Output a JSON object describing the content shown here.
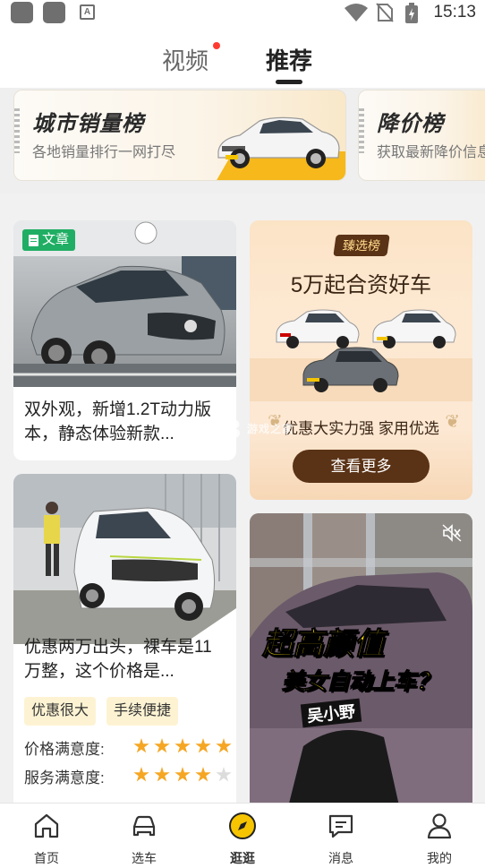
{
  "status_bar": {
    "time": "15:13"
  },
  "top_tabs": {
    "video": "视频",
    "recommend": "推荐"
  },
  "rankings": [
    {
      "title": "城市销量榜",
      "subtitle": "各地销量排行一网打尽"
    },
    {
      "title": "降价榜",
      "subtitle": "获取最新降价信息"
    }
  ],
  "feed": {
    "article_card": {
      "badge": "文章",
      "text": "双外观，新增1.2T动力版本，静态体验新款..."
    },
    "promo_card": {
      "tag": "臻选榜",
      "title": "5万起合资好车",
      "subtitle": "优惠大实力强 家用优选",
      "button": "查看更多"
    },
    "deal_card": {
      "text": "优惠两万出头，裸车是11万整，这个价格是...",
      "tags": [
        "优惠很大",
        "手续便捷"
      ],
      "ratings": [
        {
          "label": "价格满意度:",
          "stars": 5
        },
        {
          "label": "服务满意度:",
          "stars": 4
        }
      ]
    },
    "video_card": {
      "caption_line1": "超高颜值",
      "caption_line2": "美女自动上车？",
      "author": "吴小野"
    },
    "watermark": "K73",
    "watermark_sub": "游戏之家"
  },
  "bottom_nav": [
    {
      "label": "首页",
      "icon": "home-icon"
    },
    {
      "label": "选车",
      "icon": "car-icon"
    },
    {
      "label": "逛逛",
      "icon": "compass-icon",
      "active": true
    },
    {
      "label": "消息",
      "icon": "message-icon"
    },
    {
      "label": "我的",
      "icon": "profile-icon"
    }
  ],
  "colors": {
    "accent_yellow": "#f6b81a",
    "article_green": "#1fae63",
    "promo_brown": "#5a3215",
    "star": "#f5a623",
    "notify_dot": "#ff3b30"
  }
}
